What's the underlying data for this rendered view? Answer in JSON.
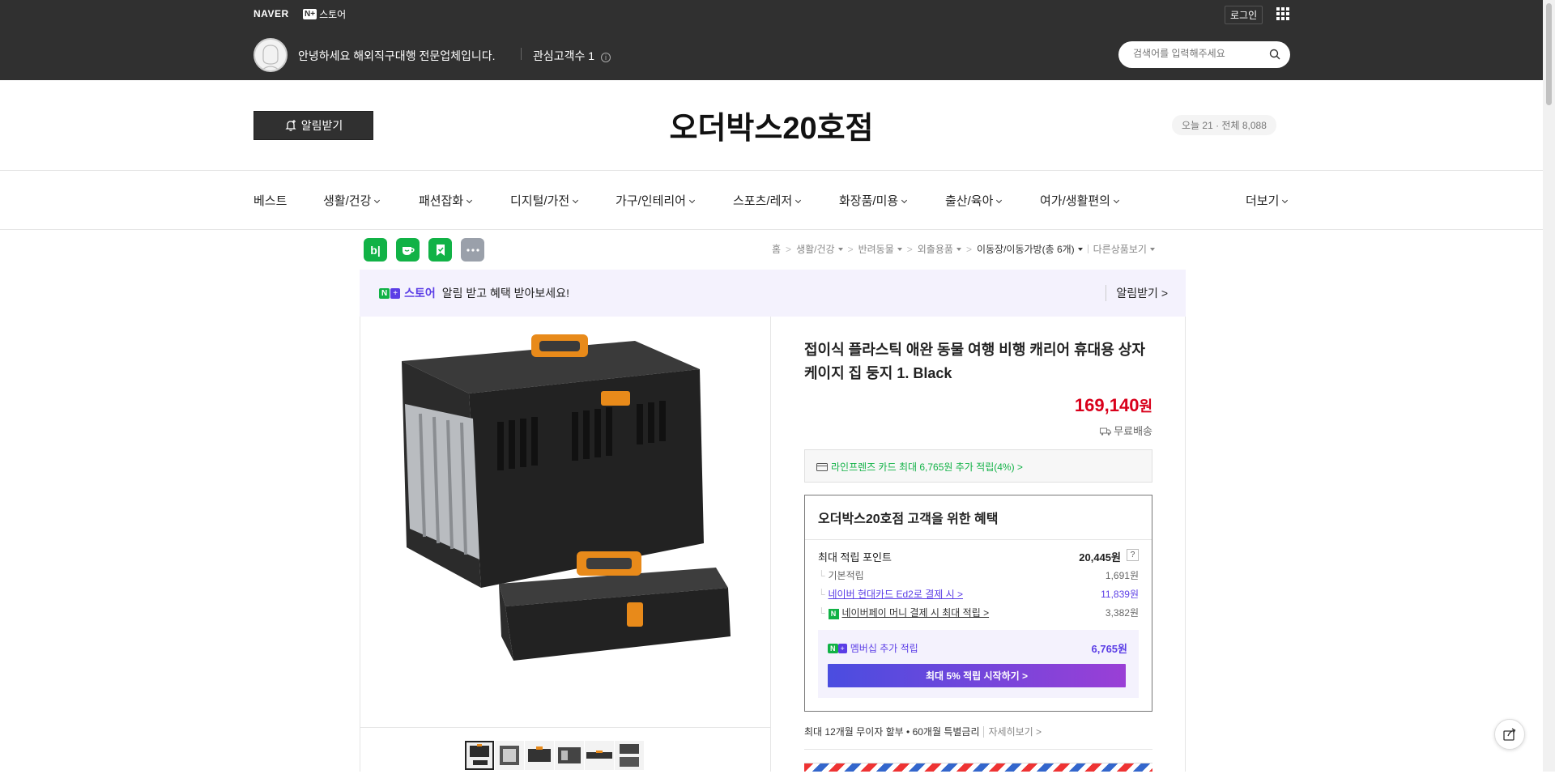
{
  "topbar": {
    "naver_logo": "NAVER",
    "nstore_label": "스토어",
    "nplus_badge": "N+",
    "login": "로그인",
    "greeting": "안녕하세요 해외직구대행 전문업체입니다.",
    "fav_customers": "관심고객수 1",
    "search_placeholder": "검색어를 입력해주세요"
  },
  "store": {
    "alarm_button": "알림받기",
    "name": "오더박스20호점",
    "visits": "오늘 21 · 전체 8,088"
  },
  "categories": [
    {
      "label": "베스트",
      "has_menu": false
    },
    {
      "label": "생활/건강",
      "has_menu": true
    },
    {
      "label": "패션잡화",
      "has_menu": true
    },
    {
      "label": "디지털/가전",
      "has_menu": true
    },
    {
      "label": "가구/인테리어",
      "has_menu": true
    },
    {
      "label": "스포츠/레저",
      "has_menu": true
    },
    {
      "label": "화장품/미용",
      "has_menu": true
    },
    {
      "label": "출산/육아",
      "has_menu": true
    },
    {
      "label": "여가/생활편의",
      "has_menu": true
    },
    {
      "label": "더보기",
      "has_menu": true
    }
  ],
  "share": {
    "blog": "b|",
    "colors": {
      "blog": "#11b246",
      "cafe": "#11b246",
      "bookmark": "#11b246",
      "more": "#9aa0aa"
    }
  },
  "breadcrumb": {
    "home": "홈",
    "c1": "생활/건강",
    "c2": "반려동물",
    "c3": "외출용품",
    "c4": "이동장/이동가방(총 6개)",
    "other": "다른상품보기"
  },
  "promo": {
    "nplus": "N",
    "plus": "+",
    "store": "스토어",
    "text": "알림 받고 혜택 받아보세요!",
    "action": "알림받기 >"
  },
  "product": {
    "title": "접이식 플라스틱 애완 동물 여행 비행 캐리어 휴대용 상자 케이지 집 둥지 1. Black",
    "price": "169,140",
    "price_unit": "원",
    "shipping": "무료배송",
    "card_offer": "라인프렌즈 카드 최대 6,765원 추가 적립(4%) >",
    "thumbnail_count": 6
  },
  "benefit": {
    "heading": "오더박스20호점 고객을 위한 혜택",
    "max_points_label": "최대 적립 포인트",
    "max_points_value": "20,445원",
    "help": "?",
    "base_label": "기본적립",
    "base_value": "1,691원",
    "hyundai_label": "네이버 현대카드 Ed2로 결제 시 >",
    "hyundai_value": "11,839원",
    "npay_label": "네이버페이 머니 결제 시 최대 적립 >",
    "npay_value": "3,382원",
    "membership_label": "멤버십 추가 적립",
    "membership_value": "6,765원",
    "membership_cta": "최대 5% 적립 시작하기 >"
  },
  "installment": {
    "text": "최대 12개월 무이자 할부 • 60개월 특별금리",
    "more": "자세히보기 >"
  },
  "colors": {
    "topbar_bg": "#303030",
    "price": "#d9001b",
    "naver_green": "#11b246",
    "accent_purple": "#5b3ee6"
  }
}
